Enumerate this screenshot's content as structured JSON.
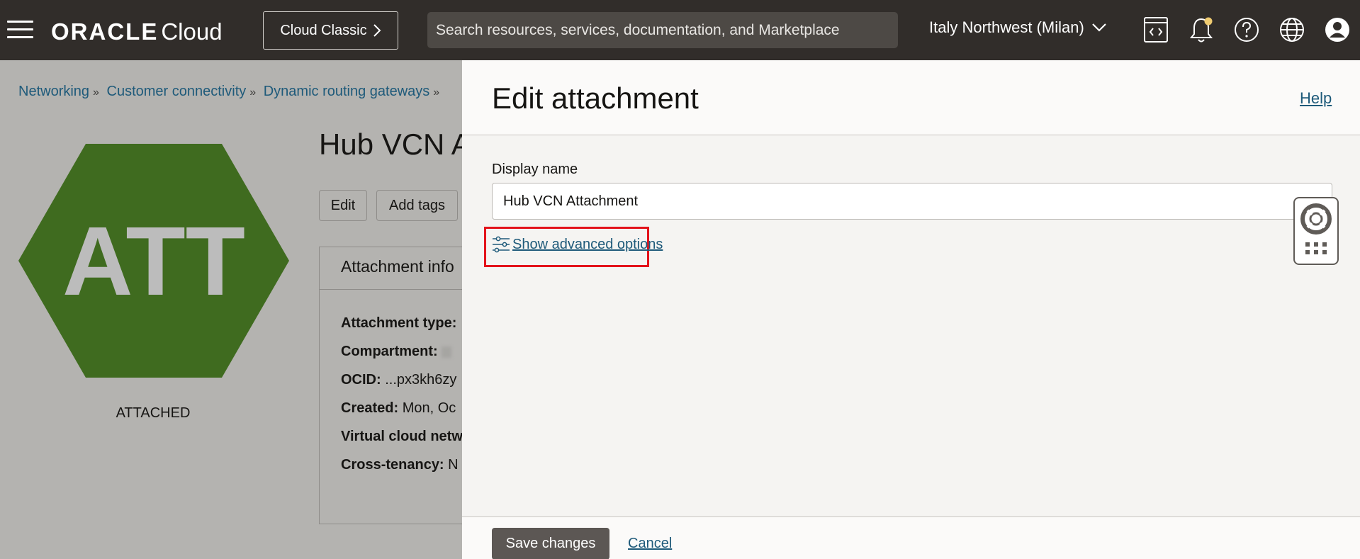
{
  "header": {
    "brand": "ORACLE",
    "brand_suffix": "Cloud",
    "cloud_classic_label": "Cloud Classic",
    "search_placeholder": "Search resources, services, documentation, and Marketplace",
    "region": "Italy Northwest (Milan)",
    "icons": [
      "menu-icon",
      "code-editor-icon",
      "bell-icon",
      "help-icon",
      "globe-icon",
      "profile-icon"
    ],
    "notification_dot_color": "#f0cc71"
  },
  "breadcrumb": [
    {
      "label": "Networking"
    },
    {
      "label": "Customer connectivity"
    },
    {
      "label": "Dynamic routing gateways"
    }
  ],
  "resource": {
    "badge_text": "ATT",
    "badge_color": "#3f6b1f",
    "status": "ATTACHED",
    "title": "Hub VCN A",
    "buttons": {
      "edit": "Edit",
      "add_tags": "Add tags"
    },
    "info_tab": "Attachment info",
    "info_rows": [
      {
        "label": "Attachment type:",
        "value": ""
      },
      {
        "label": "Compartment:",
        "value": ""
      },
      {
        "label": "OCID:",
        "value": "...px3kh6zy"
      },
      {
        "label": "Created:",
        "value": "Mon, Oc"
      },
      {
        "label": "Virtual cloud netw",
        "value": ""
      },
      {
        "label": "Cross-tenancy:",
        "value": "N"
      }
    ]
  },
  "drawer": {
    "title": "Edit attachment",
    "help_label": "Help",
    "display_name_label": "Display name",
    "display_name_value": "Hub VCN Attachment",
    "advanced_options_label": "Show advanced options",
    "highlight_color": "#e3131b",
    "save_label": "Save changes",
    "cancel_label": "Cancel"
  }
}
